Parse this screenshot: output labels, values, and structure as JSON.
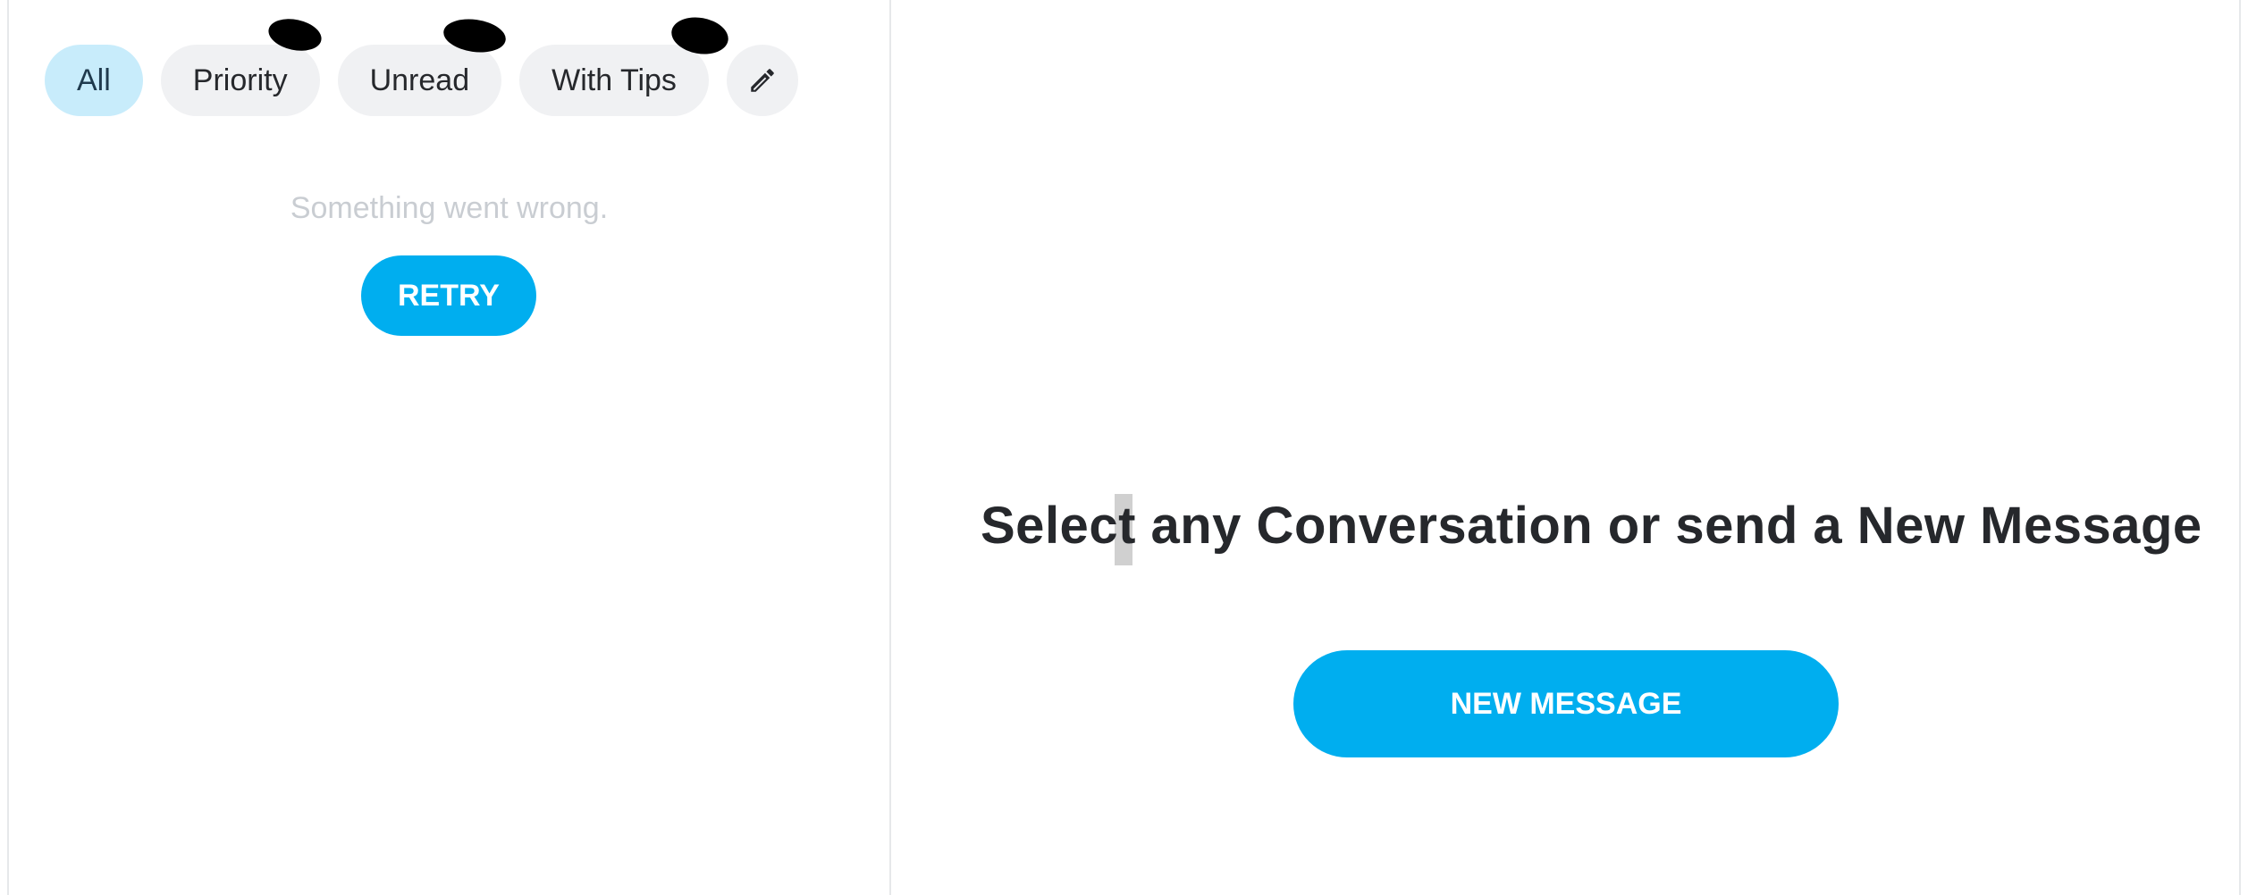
{
  "filters": {
    "items": [
      {
        "label": "All",
        "active": true
      },
      {
        "label": "Priority",
        "active": false
      },
      {
        "label": "Unread",
        "active": false
      },
      {
        "label": "With Tips",
        "active": false
      }
    ],
    "edit_icon": "pencil-icon"
  },
  "left_panel": {
    "error_message": "Something went wrong.",
    "retry_label": "RETRY"
  },
  "right_panel": {
    "title": "Select any Conversation or send a New Message",
    "new_message_label": "NEW MESSAGE"
  },
  "colors": {
    "accent": "#00aeef",
    "active_chip_bg": "#c8ecfb",
    "chip_bg": "#f0f1f3",
    "error_text": "#c9cdd2",
    "title_text": "#26282c"
  }
}
